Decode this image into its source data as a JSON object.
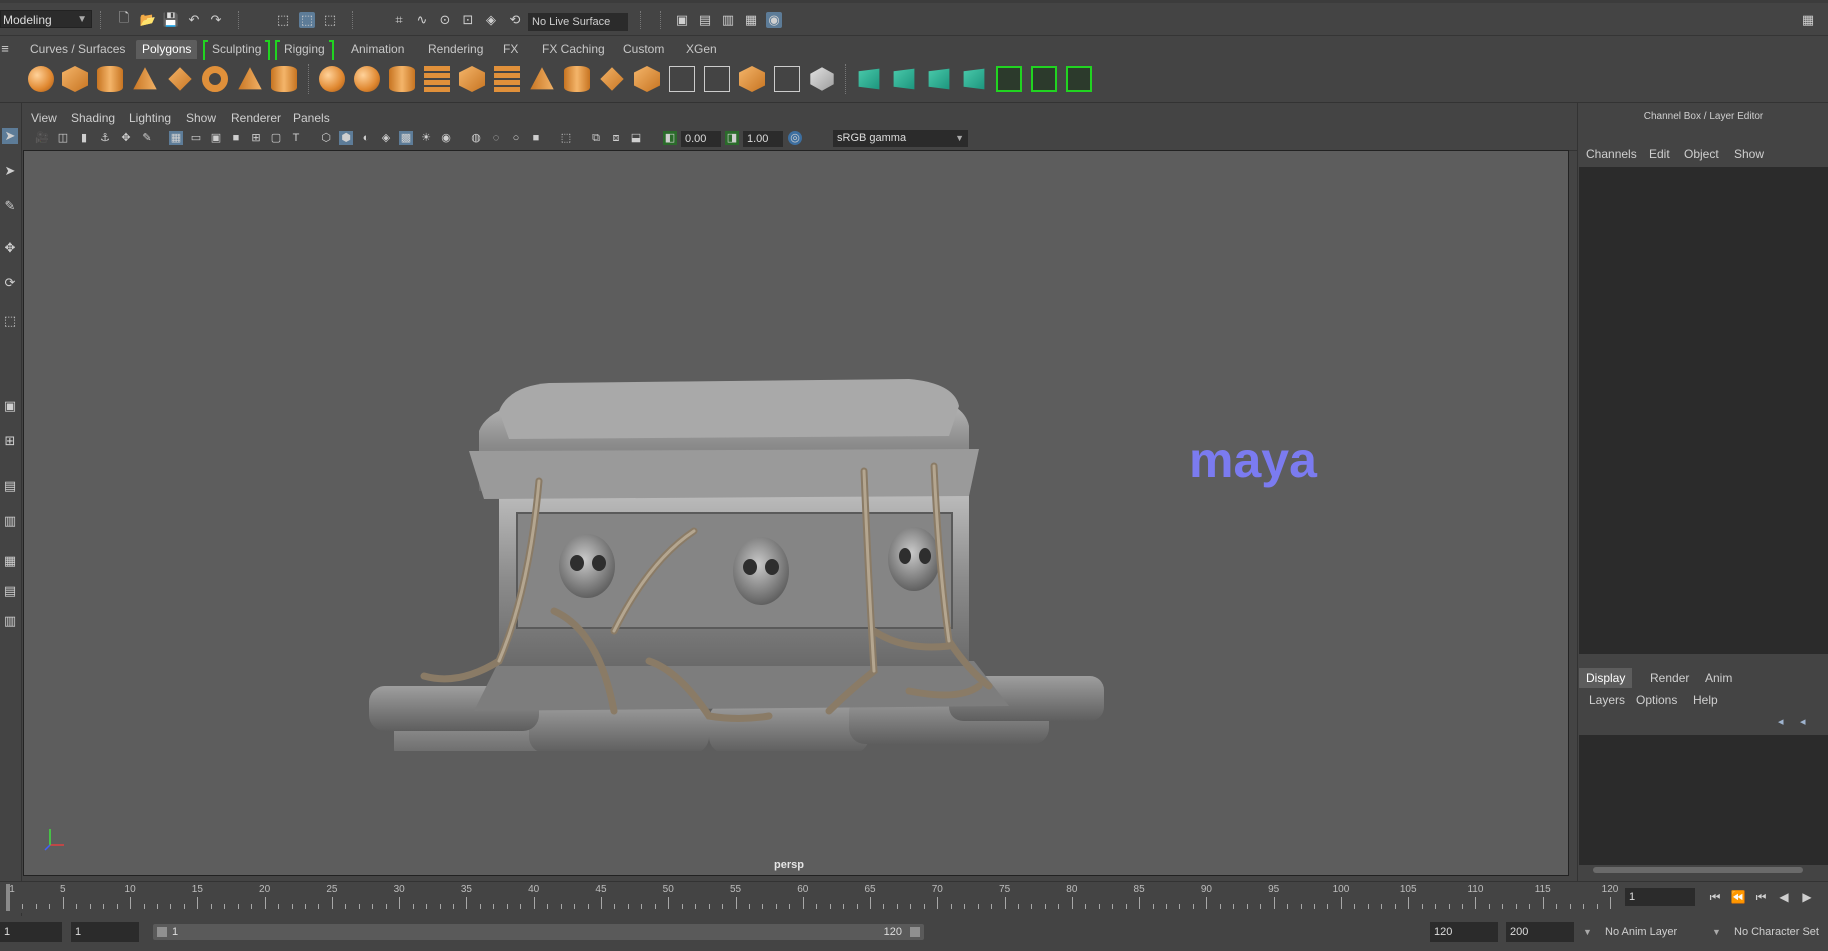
{
  "status_line": {
    "mode": "Modeling",
    "live_surface": "No Live Surface"
  },
  "shelf_tabs": [
    {
      "label": "Curves / Surfaces"
    },
    {
      "label": "Polygons"
    },
    {
      "label": "Sculpting"
    },
    {
      "label": "Rigging"
    },
    {
      "label": "Animation"
    },
    {
      "label": "Rendering"
    },
    {
      "label": "FX"
    },
    {
      "label": "FX Caching"
    },
    {
      "label": "Custom"
    },
    {
      "label": "XGen"
    }
  ],
  "active_shelf": "Polygons",
  "shelf_icons": [
    "poly-sphere-icon",
    "poly-cube-icon",
    "poly-cylinder-icon",
    "poly-cone-icon",
    "poly-diamond-icon",
    "poly-torus-icon",
    "poly-pyramid-icon",
    "poly-pipe-icon",
    "combine-icon",
    "separate-icon",
    "mirror-icon",
    "smooth-icon",
    "extract-icon",
    "boolean-icon",
    "bevel-icon",
    "bridge-icon",
    "extrude-icon",
    "multicut-icon",
    "target-weld-icon",
    "offset-edgeloop-icon",
    "insert-edgeloop-icon",
    "fill-hole-icon",
    "planar-uv-icon",
    "automatic-uv-icon",
    "uv-editor-icon"
  ],
  "panel_menu": [
    {
      "label": "View"
    },
    {
      "label": "Shading"
    },
    {
      "label": "Lighting"
    },
    {
      "label": "Show"
    },
    {
      "label": "Renderer"
    },
    {
      "label": "Panels"
    }
  ],
  "panel_toolbar": {
    "exposure": "0.00",
    "gamma": "1.00",
    "color_space": "sRGB gamma"
  },
  "viewport": {
    "camera": "persp",
    "watermark": "maya"
  },
  "right_panel": {
    "title": "Channel Box / Layer Editor",
    "channel_menu": [
      {
        "label": "Channels"
      },
      {
        "label": "Edit"
      },
      {
        "label": "Object"
      },
      {
        "label": "Show"
      }
    ],
    "layer_tabs": [
      {
        "label": "Display"
      },
      {
        "label": "Render"
      },
      {
        "label": "Anim"
      }
    ],
    "layer_menu": [
      {
        "label": "Layers"
      },
      {
        "label": "Options"
      },
      {
        "label": "Help"
      }
    ]
  },
  "time_slider": {
    "tick_labels": [
      "1",
      "5",
      "10",
      "15",
      "20",
      "25",
      "30",
      "35",
      "40",
      "45",
      "50",
      "55",
      "60",
      "65",
      "70",
      "75",
      "80",
      "85",
      "90",
      "95",
      "100",
      "105",
      "110",
      "115",
      "120"
    ],
    "current_frame": "1"
  },
  "range_slider": {
    "start_time": "1",
    "playback_start": "1",
    "range_start_label": "1",
    "range_end_label": "120",
    "playback_end": "120",
    "end_time": "200",
    "anim_layer": "No Anim Layer",
    "character_set": "No Character Set"
  }
}
